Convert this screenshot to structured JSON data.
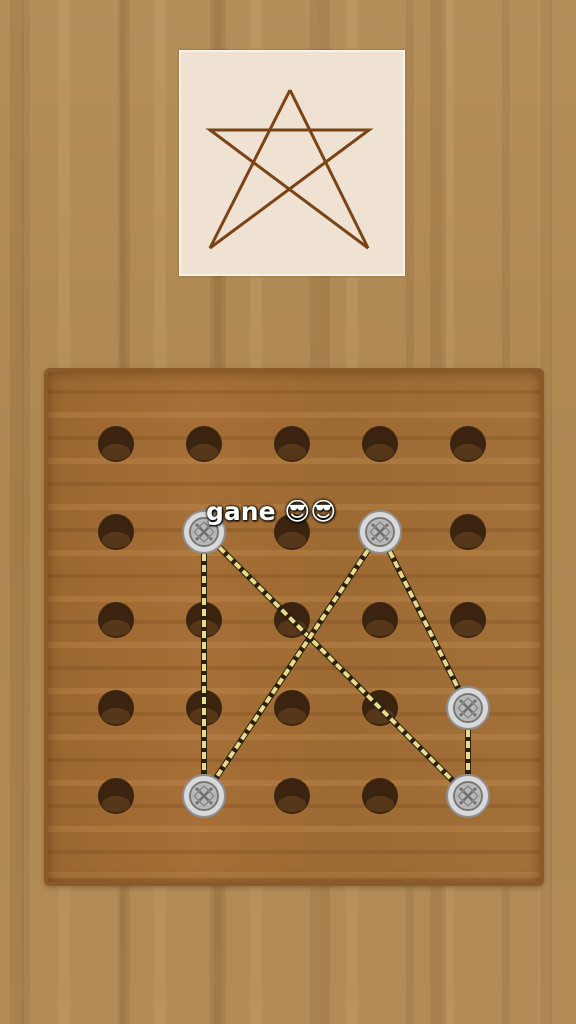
{
  "game": {
    "target_shape": "five-point-star",
    "colors": {
      "outline": "#7a4416",
      "peg_fill": "#b9b9b9",
      "rope": "#e8dc8c",
      "hole": "#3a2410"
    },
    "grid": {
      "rows": 5,
      "cols": 5
    },
    "pegs": [
      {
        "row": 1,
        "col": 1
      },
      {
        "row": 1,
        "col": 3
      },
      {
        "row": 3,
        "col": 4
      },
      {
        "row": 4,
        "col": 1
      },
      {
        "row": 4,
        "col": 4
      }
    ],
    "ropes": [
      {
        "from": [
          1,
          1
        ],
        "to": [
          4,
          1
        ]
      },
      {
        "from": [
          1,
          1
        ],
        "to": [
          4,
          4
        ]
      },
      {
        "from": [
          1,
          3
        ],
        "to": [
          4,
          1
        ]
      },
      {
        "from": [
          1,
          3
        ],
        "to": [
          3,
          4
        ]
      },
      {
        "from": [
          3,
          4
        ],
        "to": [
          4,
          4
        ]
      }
    ]
  },
  "overlay": {
    "message": "gane 😎😎"
  }
}
